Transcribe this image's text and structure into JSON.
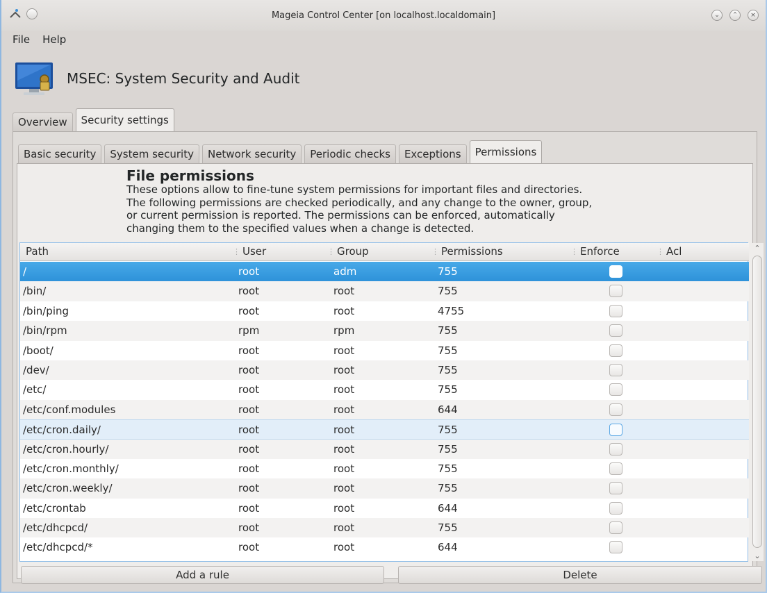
{
  "window": {
    "title": "Mageia Control Center  [on localhost.localdomain]"
  },
  "menu": {
    "file": "File",
    "help": "Help"
  },
  "header": {
    "title": "MSEC: System Security and Audit"
  },
  "outer_tabs": [
    {
      "label": "Overview"
    },
    {
      "label": "Security settings"
    }
  ],
  "inner_tabs": [
    {
      "label": "Basic security"
    },
    {
      "label": "System security"
    },
    {
      "label": "Network security"
    },
    {
      "label": "Periodic checks"
    },
    {
      "label": "Exceptions"
    },
    {
      "label": "Permissions"
    }
  ],
  "section": {
    "title": "File permissions",
    "line1": "These options allow to fine-tune system permissions for important files and directories.",
    "line2": "The following permissions are checked periodically, and any change to the owner, group,",
    "line3": "or current permission is reported. The permissions can be enforced, automatically",
    "line4": "changing them to the specified values when a change is detected."
  },
  "table": {
    "columns": [
      "Path",
      "User",
      "Group",
      "Permissions",
      "Enforce",
      "Acl"
    ],
    "rows": [
      {
        "path": "/",
        "user": "root",
        "group": "adm",
        "perm": "755"
      },
      {
        "path": "/bin/",
        "user": "root",
        "group": "root",
        "perm": "755"
      },
      {
        "path": "/bin/ping",
        "user": "root",
        "group": "root",
        "perm": "4755"
      },
      {
        "path": "/bin/rpm",
        "user": "rpm",
        "group": "rpm",
        "perm": "755"
      },
      {
        "path": "/boot/",
        "user": "root",
        "group": "root",
        "perm": "755"
      },
      {
        "path": "/dev/",
        "user": "root",
        "group": "root",
        "perm": "755"
      },
      {
        "path": "/etc/",
        "user": "root",
        "group": "root",
        "perm": "755"
      },
      {
        "path": "/etc/conf.modules",
        "user": "root",
        "group": "root",
        "perm": "644"
      },
      {
        "path": "/etc/cron.daily/",
        "user": "root",
        "group": "root",
        "perm": "755"
      },
      {
        "path": "/etc/cron.hourly/",
        "user": "root",
        "group": "root",
        "perm": "755"
      },
      {
        "path": "/etc/cron.monthly/",
        "user": "root",
        "group": "root",
        "perm": "755"
      },
      {
        "path": "/etc/cron.weekly/",
        "user": "root",
        "group": "root",
        "perm": "755"
      },
      {
        "path": "/etc/crontab",
        "user": "root",
        "group": "root",
        "perm": "644"
      },
      {
        "path": "/etc/dhcpcd/",
        "user": "root",
        "group": "root",
        "perm": "755"
      },
      {
        "path": "/etc/dhcpcd/*",
        "user": "root",
        "group": "root",
        "perm": "644"
      }
    ]
  },
  "buttons": {
    "add": "Add a rule",
    "delete": "Delete"
  },
  "colors": {
    "selection": "#3498db",
    "accent_border": "#8fbde8"
  }
}
